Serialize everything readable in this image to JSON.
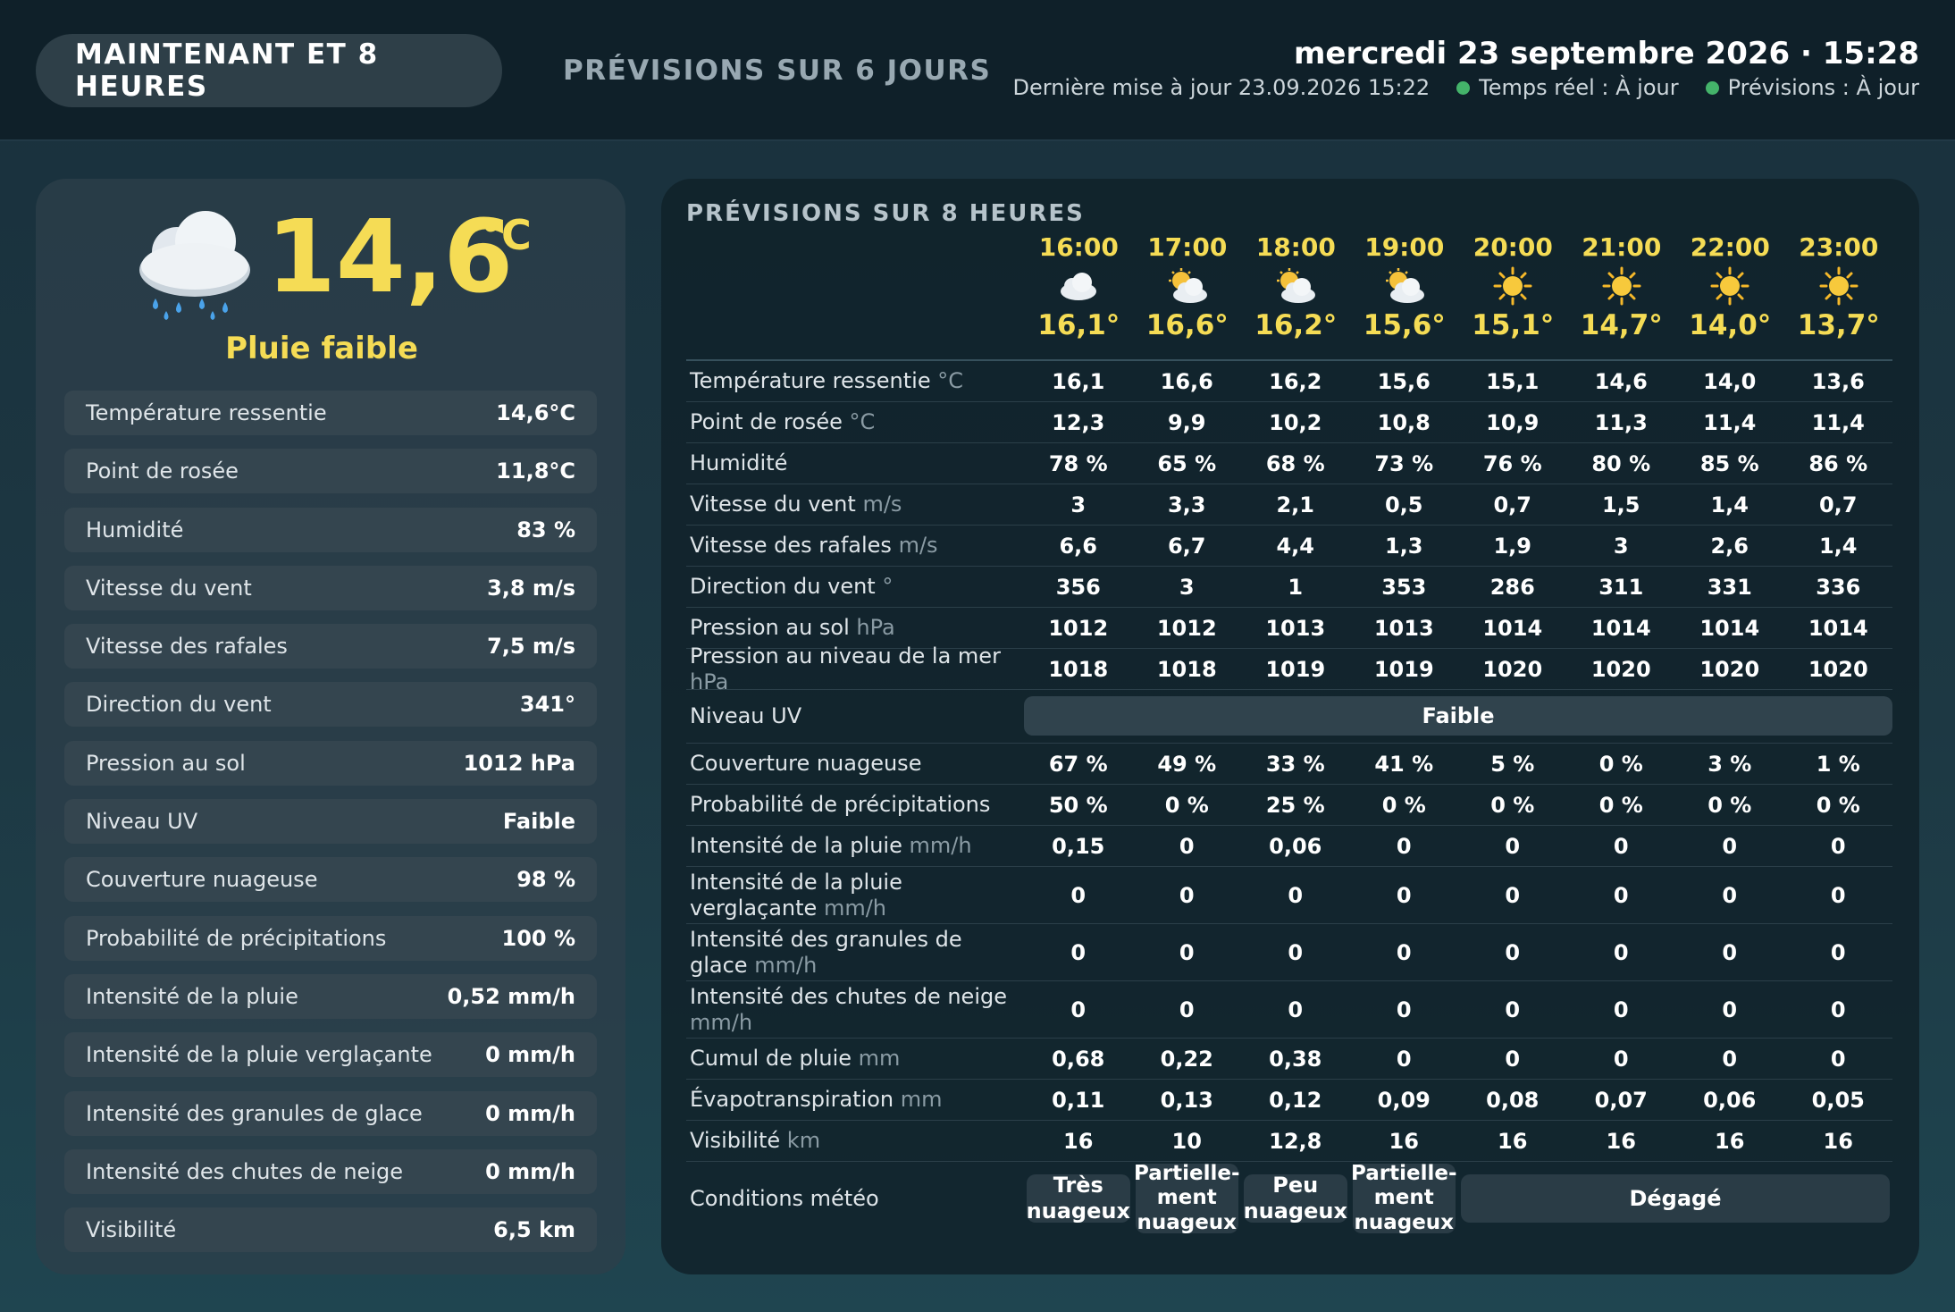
{
  "tabs": {
    "now": "MAINTENANT ET 8 HEURES",
    "forecast": "PRÉVISIONS SUR 6 JOURS"
  },
  "header": {
    "datetime": "mercredi 23 septembre 2026 · 15:28",
    "last_update": "Dernière mise à jour 23.09.2026 15:22",
    "status_realtime": "Temps réel : À jour",
    "status_forecast": "Prévisions : À jour",
    "status_color": "#44b36a"
  },
  "current": {
    "icon": "rain-cloud-icon",
    "temperature": "14,6",
    "unit": "°C",
    "condition": "Pluie faible",
    "rows": [
      {
        "label": "Température ressentie",
        "value": "14,6°C"
      },
      {
        "label": "Point de rosée",
        "value": "11,8°C"
      },
      {
        "label": "Humidité",
        "value": "83 %"
      },
      {
        "label": "Vitesse du vent",
        "value": "3,8 m/s"
      },
      {
        "label": "Vitesse des rafales",
        "value": "7,5 m/s"
      },
      {
        "label": "Direction du vent",
        "value": "341°"
      },
      {
        "label": "Pression au sol",
        "value": "1012 hPa"
      },
      {
        "label": "Niveau UV",
        "value": "Faible"
      },
      {
        "label": "Couverture nuageuse",
        "value": "98 %"
      },
      {
        "label": "Probabilité de précipitations",
        "value": "100 %"
      },
      {
        "label": "Intensité de la pluie",
        "value": "0,52 mm/h"
      },
      {
        "label": "Intensité de la pluie verglaçante",
        "value": "0 mm/h"
      },
      {
        "label": "Intensité des granules de glace",
        "value": "0 mm/h"
      },
      {
        "label": "Intensité des chutes de neige",
        "value": "0 mm/h"
      },
      {
        "label": "Visibilité",
        "value": "6,5 km"
      }
    ]
  },
  "forecast": {
    "title": "PRÉVISIONS SUR 8 HEURES",
    "hours": [
      {
        "time": "16:00",
        "icon": "cloud-icon",
        "temp": "16,1°"
      },
      {
        "time": "17:00",
        "icon": "sun-behind-cloud-icon",
        "temp": "16,6°"
      },
      {
        "time": "18:00",
        "icon": "sun-behind-cloud-icon",
        "temp": "16,2°"
      },
      {
        "time": "19:00",
        "icon": "sun-behind-cloud-icon",
        "temp": "15,6°"
      },
      {
        "time": "20:00",
        "icon": "sun-icon",
        "temp": "15,1°"
      },
      {
        "time": "21:00",
        "icon": "sun-icon",
        "temp": "14,7°"
      },
      {
        "time": "22:00",
        "icon": "sun-icon",
        "temp": "14,0°"
      },
      {
        "time": "23:00",
        "icon": "sun-icon",
        "temp": "13,7°"
      }
    ],
    "rows": [
      {
        "label": "Température ressentie",
        "unit": "°C",
        "h": 46,
        "values": [
          "16,1",
          "16,6",
          "16,2",
          "15,6",
          "15,1",
          "14,6",
          "14,0",
          "13,6"
        ]
      },
      {
        "label": "Point de rosée",
        "unit": "°C",
        "h": 46,
        "values": [
          "12,3",
          "9,9",
          "10,2",
          "10,8",
          "10,9",
          "11,3",
          "11,4",
          "11,4"
        ]
      },
      {
        "label": "Humidité",
        "unit": "",
        "h": 46,
        "values": [
          "78 %",
          "65 %",
          "68 %",
          "73 %",
          "76 %",
          "80 %",
          "85 %",
          "86 %"
        ]
      },
      {
        "label": "Vitesse du vent",
        "unit": "m/s",
        "h": 46,
        "values": [
          "3",
          "3,3",
          "2,1",
          "0,5",
          "0,7",
          "1,5",
          "1,4",
          "0,7"
        ]
      },
      {
        "label": "Vitesse des rafales",
        "unit": "m/s",
        "h": 46,
        "values": [
          "6,6",
          "6,7",
          "4,4",
          "1,3",
          "1,9",
          "3",
          "2,6",
          "1,4"
        ]
      },
      {
        "label": "Direction du vent",
        "unit": "°",
        "h": 46,
        "values": [
          "356",
          "3",
          "1",
          "353",
          "286",
          "311",
          "331",
          "336"
        ]
      },
      {
        "label": "Pression au sol",
        "unit": "hPa",
        "h": 46,
        "values": [
          "1012",
          "1012",
          "1013",
          "1013",
          "1014",
          "1014",
          "1014",
          "1014"
        ]
      },
      {
        "label": "Pression au niveau de la mer",
        "unit": "hPa",
        "h": 46,
        "values": [
          "1018",
          "1018",
          "1019",
          "1019",
          "1020",
          "1020",
          "1020",
          "1020"
        ]
      },
      {
        "label": "Niveau UV",
        "unit": "",
        "h": 60,
        "merged": "Faible"
      },
      {
        "label": "Couverture nuageuse",
        "unit": "",
        "h": 46,
        "values": [
          "67 %",
          "49 %",
          "33 %",
          "41 %",
          "5 %",
          "0 %",
          "3 %",
          "1 %"
        ]
      },
      {
        "label": "Probabilité de précipitations",
        "unit": "",
        "h": 46,
        "values": [
          "50 %",
          "0 %",
          "25 %",
          "0 %",
          "0 %",
          "0 %",
          "0 %",
          "0 %"
        ]
      },
      {
        "label": "Intensité de la pluie",
        "unit": "mm/h",
        "h": 46,
        "values": [
          "0,15",
          "0",
          "0,06",
          "0",
          "0",
          "0",
          "0",
          "0"
        ]
      },
      {
        "label": "Intensité de la pluie verglaçante",
        "unit": "mm/h",
        "h": 64,
        "values": [
          "0",
          "0",
          "0",
          "0",
          "0",
          "0",
          "0",
          "0"
        ]
      },
      {
        "label": "Intensité des granules de glace",
        "unit": "mm/h",
        "h": 64,
        "values": [
          "0",
          "0",
          "0",
          "0",
          "0",
          "0",
          "0",
          "0"
        ]
      },
      {
        "label": "Intensité des chutes de neige",
        "unit": "mm/h",
        "h": 64,
        "values": [
          "0",
          "0",
          "0",
          "0",
          "0",
          "0",
          "0",
          "0"
        ]
      },
      {
        "label": "Cumul de pluie",
        "unit": "mm",
        "h": 46,
        "values": [
          "0,68",
          "0,22",
          "0,38",
          "0",
          "0",
          "0",
          "0",
          "0"
        ]
      },
      {
        "label": "Évapotranspiration",
        "unit": "mm",
        "h": 46,
        "values": [
          "0,11",
          "0,13",
          "0,12",
          "0,09",
          "0,08",
          "0,07",
          "0,06",
          "0,05"
        ]
      },
      {
        "label": "Visibilité",
        "unit": "km",
        "h": 46,
        "values": [
          "16",
          "10",
          "12,8",
          "16",
          "16",
          "16",
          "16",
          "16"
        ]
      }
    ],
    "conditions": {
      "label": "Conditions météo",
      "cells": [
        {
          "text": "Très\nnuageux",
          "start": 0,
          "span": 1
        },
        {
          "text": "Partielle-\nment\nnuageux",
          "start": 1,
          "span": 1
        },
        {
          "text": "Peu\nnuageux",
          "start": 2,
          "span": 1
        },
        {
          "text": "Partielle-\nment\nnuageux",
          "start": 3,
          "span": 1
        },
        {
          "text": "Dégagé",
          "start": 4,
          "span": 4
        }
      ]
    }
  }
}
